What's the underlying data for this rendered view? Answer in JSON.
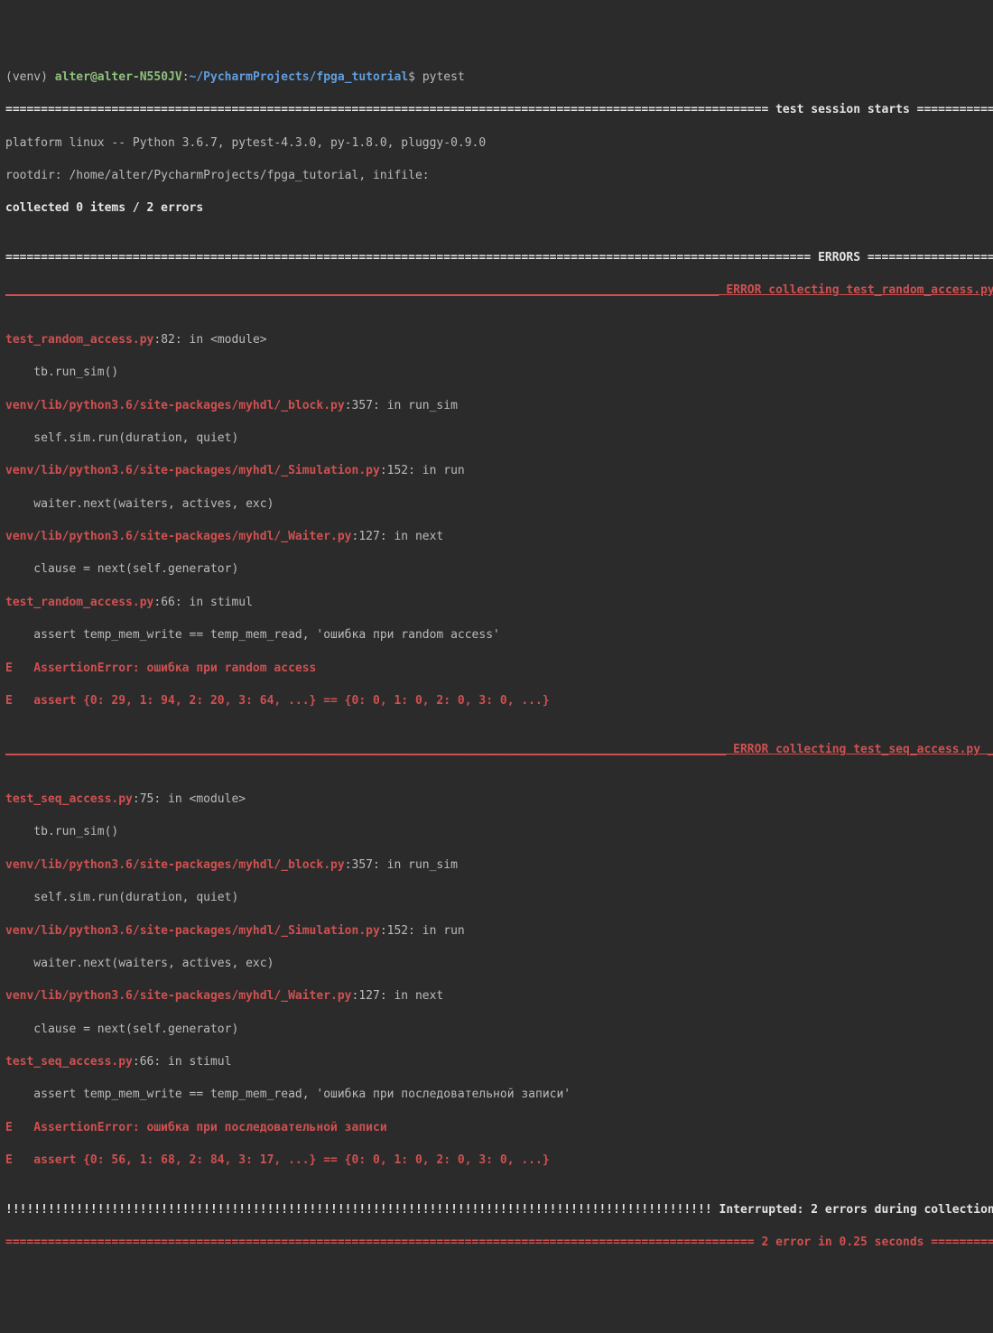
{
  "prompt": {
    "venv": "(venv) ",
    "user": "alter",
    "at": "@",
    "host": "alter-N550JV",
    "colon": ":",
    "path": "~/PycharmProjects/fpga_tutorial",
    "dollar": "$ ",
    "cmd": "pytest"
  },
  "session_header": "============================================================================================================ test session starts =====================",
  "platform_line": "platform linux -- Python 3.6.7, pytest-4.3.0, py-1.8.0, pluggy-0.9.0",
  "rootdir_line": "rootdir: /home/alter/PycharmProjects/fpga_tutorial, inifile:",
  "collected_line": "collected 0 items / 2 errors",
  "blank": "",
  "errors_header": "================================================================================================================== ERRORS =============================",
  "err1_header": "_____________________________________________________________________________________________________ ERROR collecting test_random_access.py _________",
  "trace1": [
    {
      "path": "test_random_access.py",
      "loc": ":82: in <module>"
    },
    {
      "code": "    tb.run_sim()"
    },
    {
      "path": "venv/lib/python3.6/site-packages/myhdl/_block.py",
      "loc": ":357: in run_sim"
    },
    {
      "code": "    self.sim.run(duration, quiet)"
    },
    {
      "path": "venv/lib/python3.6/site-packages/myhdl/_Simulation.py",
      "loc": ":152: in run"
    },
    {
      "code": "    waiter.next(waiters, actives, exc)"
    },
    {
      "path": "venv/lib/python3.6/site-packages/myhdl/_Waiter.py",
      "loc": ":127: in next"
    },
    {
      "code": "    clause = next(self.generator)"
    },
    {
      "path": "test_random_access.py",
      "loc": ":66: in stimul"
    },
    {
      "code": "    assert temp_mem_write == temp_mem_read, 'ошибка при random access'"
    }
  ],
  "err1_assert1": "E   AssertionError: ошибка при random access",
  "err1_assert2": "E   assert {0: 29, 1: 94, 2: 20, 3: 64, ...} == {0: 0, 1: 0, 2: 0, 3: 0, ...}",
  "err2_header": "______________________________________________________________________________________________________ ERROR collecting test_seq_access.py ___________",
  "trace2": [
    {
      "path": "test_seq_access.py",
      "loc": ":75: in <module>"
    },
    {
      "code": "    tb.run_sim()"
    },
    {
      "path": "venv/lib/python3.6/site-packages/myhdl/_block.py",
      "loc": ":357: in run_sim"
    },
    {
      "code": "    self.sim.run(duration, quiet)"
    },
    {
      "path": "venv/lib/python3.6/site-packages/myhdl/_Simulation.py",
      "loc": ":152: in run"
    },
    {
      "code": "    waiter.next(waiters, actives, exc)"
    },
    {
      "path": "venv/lib/python3.6/site-packages/myhdl/_Waiter.py",
      "loc": ":127: in next"
    },
    {
      "code": "    clause = next(self.generator)"
    },
    {
      "path": "test_seq_access.py",
      "loc": ":66: in stimul"
    },
    {
      "code": "    assert temp_mem_write == temp_mem_read, 'ошибка при последовательной записи'"
    }
  ],
  "err2_assert1": "E   AssertionError: ошибка при последовательной записи",
  "err2_assert2": "E   assert {0: 56, 1: 68, 2: 84, 3: 17, ...} == {0: 0, 1: 0, 2: 0, 3: 0, ...}",
  "interrupted_line": "!!!!!!!!!!!!!!!!!!!!!!!!!!!!!!!!!!!!!!!!!!!!!!!!!!!!!!!!!!!!!!!!!!!!!!!!!!!!!!!!!!!!!!!!!!!!!!!!!!!! Interrupted: 2 errors during collection !!!!!",
  "summary_line": "========================================================================================================== 2 error in 0.25 seconds ===================="
}
